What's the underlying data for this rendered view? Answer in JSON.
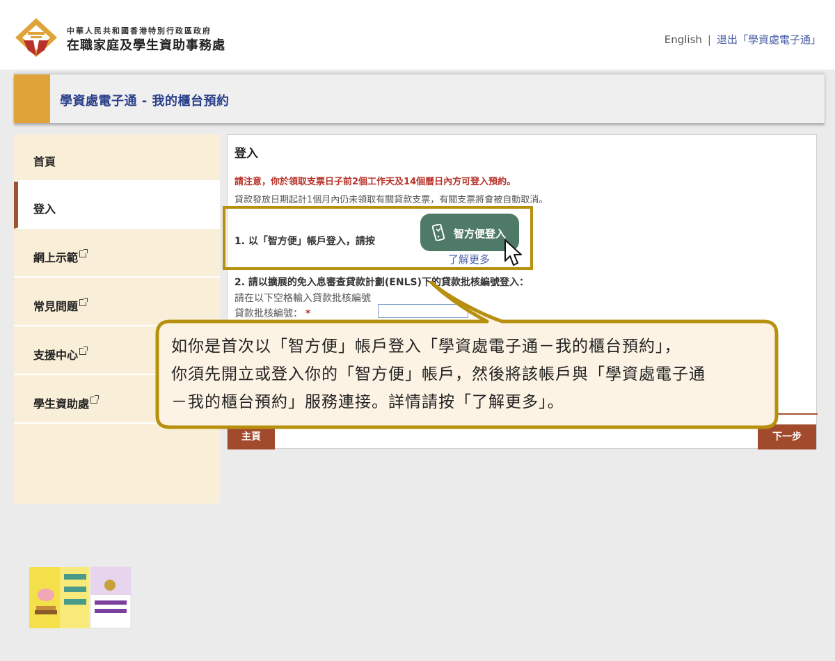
{
  "header": {
    "org_line_small": "中華人民共和國香港特別行政區政府",
    "org_line_big": "在職家庭及學生資助事務處",
    "english_link": "English",
    "separator": "|",
    "logout_link": "退出「學資處電子通」"
  },
  "titlebar": {
    "title": "學資處電子通 - 我的櫃台預約"
  },
  "sidebar": {
    "items": [
      {
        "label": "首頁",
        "active": false,
        "external": false
      },
      {
        "label": "登入",
        "active": true,
        "external": false
      },
      {
        "label": "網上示範",
        "active": false,
        "external": true
      },
      {
        "label": "常見問題",
        "active": false,
        "external": true
      },
      {
        "label": "支援中心",
        "active": false,
        "external": true
      },
      {
        "label": "學生資助處",
        "active": false,
        "external": true
      }
    ]
  },
  "main": {
    "heading": "登入",
    "notice": "請注意，你於領取支票日子前2個工作天及14個曆日內方可登入預約。",
    "note": "貸款發放日期起計1個月內仍未領取有關貸款支票，有關支票將會被自動取消。",
    "option1_text": "1. 以「智方便」帳戶登入，請按",
    "iam_button_label": "智方便登入",
    "learn_more_link": "了解更多",
    "option2_text": "2. 請以擴展的免入息審查貸款計劃(ENLS)下的貸款批核編號登入：",
    "option2_hint": "請在以下空格輸入貸款批核編號",
    "field_label": "貸款批核編號：",
    "required_mark": "*",
    "field_value": "",
    "home_button": "主頁",
    "next_button": "下一步"
  },
  "callout": {
    "lines": [
      "如你是首次以「智方便」帳戶登入「學資處電子通－我的櫃台預約」，",
      "你須先開立或登入你的「智方便」帳戶，然後將該帳戶與「學資處電子通",
      "－我的櫃台預約」服務連接。詳情請按「了解更多」。"
    ]
  },
  "colors": {
    "accent_gold": "#e0a33a",
    "brand_brown": "#a14a2c",
    "title_blue": "#2a3f8a",
    "iam_green": "#4f7a68",
    "highlight_gold": "#b8900f",
    "notice_red": "#b8322a"
  }
}
